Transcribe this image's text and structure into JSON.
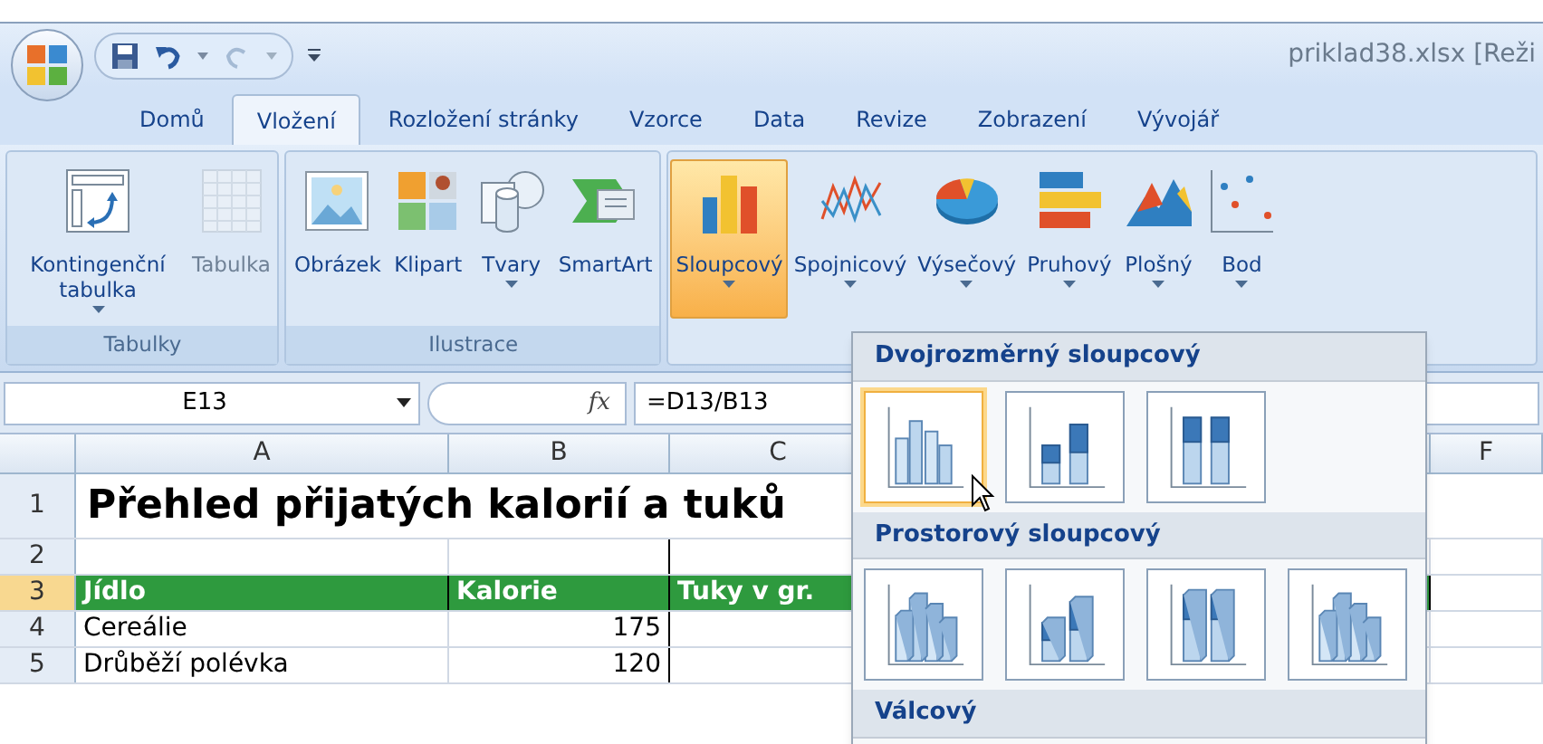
{
  "window": {
    "title": "priklad38.xlsx  [Reži"
  },
  "tabs": [
    {
      "label": "Domů",
      "selected": false
    },
    {
      "label": "Vložení",
      "selected": true
    },
    {
      "label": "Rozložení stránky",
      "selected": false
    },
    {
      "label": "Vzorce",
      "selected": false
    },
    {
      "label": "Data",
      "selected": false
    },
    {
      "label": "Revize",
      "selected": false
    },
    {
      "label": "Zobrazení",
      "selected": false
    },
    {
      "label": "Vývojář",
      "selected": false
    }
  ],
  "ribbon_groups": [
    {
      "label": "Tabulky",
      "buttons": [
        {
          "kind": "pivot",
          "label": "Kontingenční tabulka",
          "dropdown": true,
          "disabled": false,
          "selected": false
        },
        {
          "kind": "table",
          "label": "Tabulka",
          "dropdown": false,
          "disabled": true,
          "selected": false
        }
      ]
    },
    {
      "label": "Ilustrace",
      "buttons": [
        {
          "kind": "picture",
          "label": "Obrázek",
          "dropdown": false,
          "disabled": false,
          "selected": false
        },
        {
          "kind": "clipart",
          "label": "Klipart",
          "dropdown": false,
          "disabled": false,
          "selected": false
        },
        {
          "kind": "shapes",
          "label": "Tvary",
          "dropdown": true,
          "disabled": false,
          "selected": false
        },
        {
          "kind": "smartart",
          "label": "SmartArt",
          "dropdown": false,
          "disabled": false,
          "selected": false
        }
      ]
    },
    {
      "buttons": [
        {
          "kind": "column",
          "label": "Sloupcový",
          "dropdown": true,
          "disabled": false,
          "selected": true
        },
        {
          "kind": "line",
          "label": "Spojnicový",
          "dropdown": true,
          "disabled": false,
          "selected": false
        },
        {
          "kind": "pie",
          "label": "Výsečový",
          "dropdown": true,
          "disabled": false,
          "selected": false
        },
        {
          "kind": "bar",
          "label": "Pruhový",
          "dropdown": true,
          "disabled": false,
          "selected": false
        },
        {
          "kind": "area",
          "label": "Plošný",
          "dropdown": true,
          "disabled": false,
          "selected": false
        },
        {
          "kind": "scatter",
          "label": "Bod",
          "dropdown": true,
          "disabled": false,
          "selected": false
        }
      ]
    }
  ],
  "formula_bar": {
    "name_box": "E13",
    "function_symbol": "fx",
    "formula": "=D13/B13"
  },
  "sheet": {
    "columns": [
      {
        "label": "A"
      },
      {
        "label": "B"
      },
      {
        "label": "C"
      },
      {
        "label": "F"
      }
    ],
    "rows": [
      {
        "number": "1",
        "kind": "title",
        "selected": false,
        "cells": [
          "Přehled přijatých kalorií a tuků"
        ]
      },
      {
        "number": "2",
        "kind": "data",
        "selected": false,
        "cells": []
      },
      {
        "number": "3",
        "kind": "header",
        "selected": true,
        "cells": [
          "Jídlo",
          "Kalorie",
          "Tuky v gr."
        ]
      },
      {
        "number": "4",
        "kind": "data",
        "selected": false,
        "cells": [
          "Cereálie",
          "175"
        ]
      },
      {
        "number": "5",
        "kind": "data",
        "selected": false,
        "cells": [
          "Drůběží polévka",
          "120"
        ]
      }
    ]
  },
  "chart_menu": {
    "sections": [
      {
        "title": "Dvojrozměrný sloupcový",
        "items": [
          {
            "kind": "clustered",
            "selected": true
          },
          {
            "kind": "stacked",
            "selected": false
          },
          {
            "kind": "percent",
            "selected": false
          }
        ]
      },
      {
        "title": "Prostorový sloupcový",
        "items": [
          {
            "kind": "clustered3d",
            "selected": false
          },
          {
            "kind": "stacked3d",
            "selected": false
          },
          {
            "kind": "percent3d",
            "selected": false
          },
          {
            "kind": "column3d",
            "selected": false
          }
        ]
      },
      {
        "title": "Válcový"
      }
    ]
  }
}
